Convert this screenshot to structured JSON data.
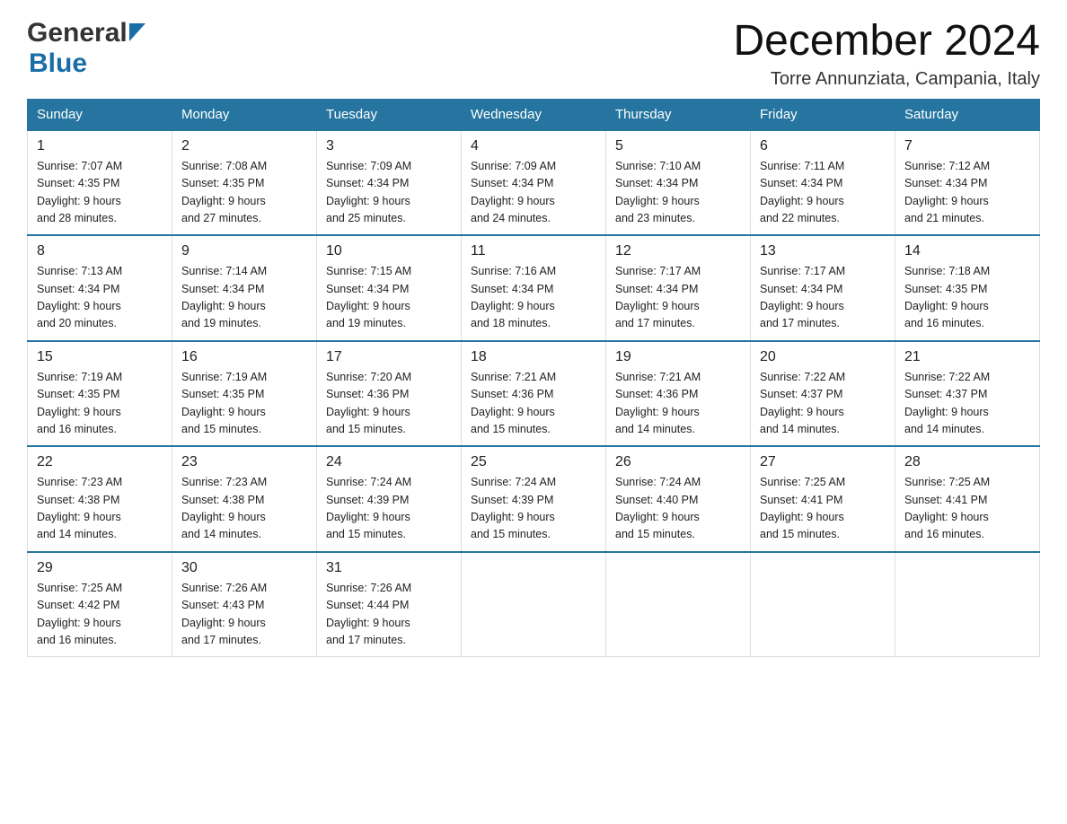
{
  "header": {
    "logo_general": "General",
    "logo_blue": "Blue",
    "month_title": "December 2024",
    "location": "Torre Annunziata, Campania, Italy"
  },
  "days_of_week": [
    "Sunday",
    "Monday",
    "Tuesday",
    "Wednesday",
    "Thursday",
    "Friday",
    "Saturday"
  ],
  "weeks": [
    [
      {
        "day": "1",
        "sunrise": "7:07 AM",
        "sunset": "4:35 PM",
        "daylight": "9 hours and 28 minutes."
      },
      {
        "day": "2",
        "sunrise": "7:08 AM",
        "sunset": "4:35 PM",
        "daylight": "9 hours and 27 minutes."
      },
      {
        "day": "3",
        "sunrise": "7:09 AM",
        "sunset": "4:34 PM",
        "daylight": "9 hours and 25 minutes."
      },
      {
        "day": "4",
        "sunrise": "7:09 AM",
        "sunset": "4:34 PM",
        "daylight": "9 hours and 24 minutes."
      },
      {
        "day": "5",
        "sunrise": "7:10 AM",
        "sunset": "4:34 PM",
        "daylight": "9 hours and 23 minutes."
      },
      {
        "day": "6",
        "sunrise": "7:11 AM",
        "sunset": "4:34 PM",
        "daylight": "9 hours and 22 minutes."
      },
      {
        "day": "7",
        "sunrise": "7:12 AM",
        "sunset": "4:34 PM",
        "daylight": "9 hours and 21 minutes."
      }
    ],
    [
      {
        "day": "8",
        "sunrise": "7:13 AM",
        "sunset": "4:34 PM",
        "daylight": "9 hours and 20 minutes."
      },
      {
        "day": "9",
        "sunrise": "7:14 AM",
        "sunset": "4:34 PM",
        "daylight": "9 hours and 19 minutes."
      },
      {
        "day": "10",
        "sunrise": "7:15 AM",
        "sunset": "4:34 PM",
        "daylight": "9 hours and 19 minutes."
      },
      {
        "day": "11",
        "sunrise": "7:16 AM",
        "sunset": "4:34 PM",
        "daylight": "9 hours and 18 minutes."
      },
      {
        "day": "12",
        "sunrise": "7:17 AM",
        "sunset": "4:34 PM",
        "daylight": "9 hours and 17 minutes."
      },
      {
        "day": "13",
        "sunrise": "7:17 AM",
        "sunset": "4:34 PM",
        "daylight": "9 hours and 17 minutes."
      },
      {
        "day": "14",
        "sunrise": "7:18 AM",
        "sunset": "4:35 PM",
        "daylight": "9 hours and 16 minutes."
      }
    ],
    [
      {
        "day": "15",
        "sunrise": "7:19 AM",
        "sunset": "4:35 PM",
        "daylight": "9 hours and 16 minutes."
      },
      {
        "day": "16",
        "sunrise": "7:19 AM",
        "sunset": "4:35 PM",
        "daylight": "9 hours and 15 minutes."
      },
      {
        "day": "17",
        "sunrise": "7:20 AM",
        "sunset": "4:36 PM",
        "daylight": "9 hours and 15 minutes."
      },
      {
        "day": "18",
        "sunrise": "7:21 AM",
        "sunset": "4:36 PM",
        "daylight": "9 hours and 15 minutes."
      },
      {
        "day": "19",
        "sunrise": "7:21 AM",
        "sunset": "4:36 PM",
        "daylight": "9 hours and 14 minutes."
      },
      {
        "day": "20",
        "sunrise": "7:22 AM",
        "sunset": "4:37 PM",
        "daylight": "9 hours and 14 minutes."
      },
      {
        "day": "21",
        "sunrise": "7:22 AM",
        "sunset": "4:37 PM",
        "daylight": "9 hours and 14 minutes."
      }
    ],
    [
      {
        "day": "22",
        "sunrise": "7:23 AM",
        "sunset": "4:38 PM",
        "daylight": "9 hours and 14 minutes."
      },
      {
        "day": "23",
        "sunrise": "7:23 AM",
        "sunset": "4:38 PM",
        "daylight": "9 hours and 14 minutes."
      },
      {
        "day": "24",
        "sunrise": "7:24 AM",
        "sunset": "4:39 PM",
        "daylight": "9 hours and 15 minutes."
      },
      {
        "day": "25",
        "sunrise": "7:24 AM",
        "sunset": "4:39 PM",
        "daylight": "9 hours and 15 minutes."
      },
      {
        "day": "26",
        "sunrise": "7:24 AM",
        "sunset": "4:40 PM",
        "daylight": "9 hours and 15 minutes."
      },
      {
        "day": "27",
        "sunrise": "7:25 AM",
        "sunset": "4:41 PM",
        "daylight": "9 hours and 15 minutes."
      },
      {
        "day": "28",
        "sunrise": "7:25 AM",
        "sunset": "4:41 PM",
        "daylight": "9 hours and 16 minutes."
      }
    ],
    [
      {
        "day": "29",
        "sunrise": "7:25 AM",
        "sunset": "4:42 PM",
        "daylight": "9 hours and 16 minutes."
      },
      {
        "day": "30",
        "sunrise": "7:26 AM",
        "sunset": "4:43 PM",
        "daylight": "9 hours and 17 minutes."
      },
      {
        "day": "31",
        "sunrise": "7:26 AM",
        "sunset": "4:44 PM",
        "daylight": "9 hours and 17 minutes."
      },
      null,
      null,
      null,
      null
    ]
  ],
  "labels": {
    "sunrise": "Sunrise:",
    "sunset": "Sunset:",
    "daylight": "Daylight:"
  }
}
